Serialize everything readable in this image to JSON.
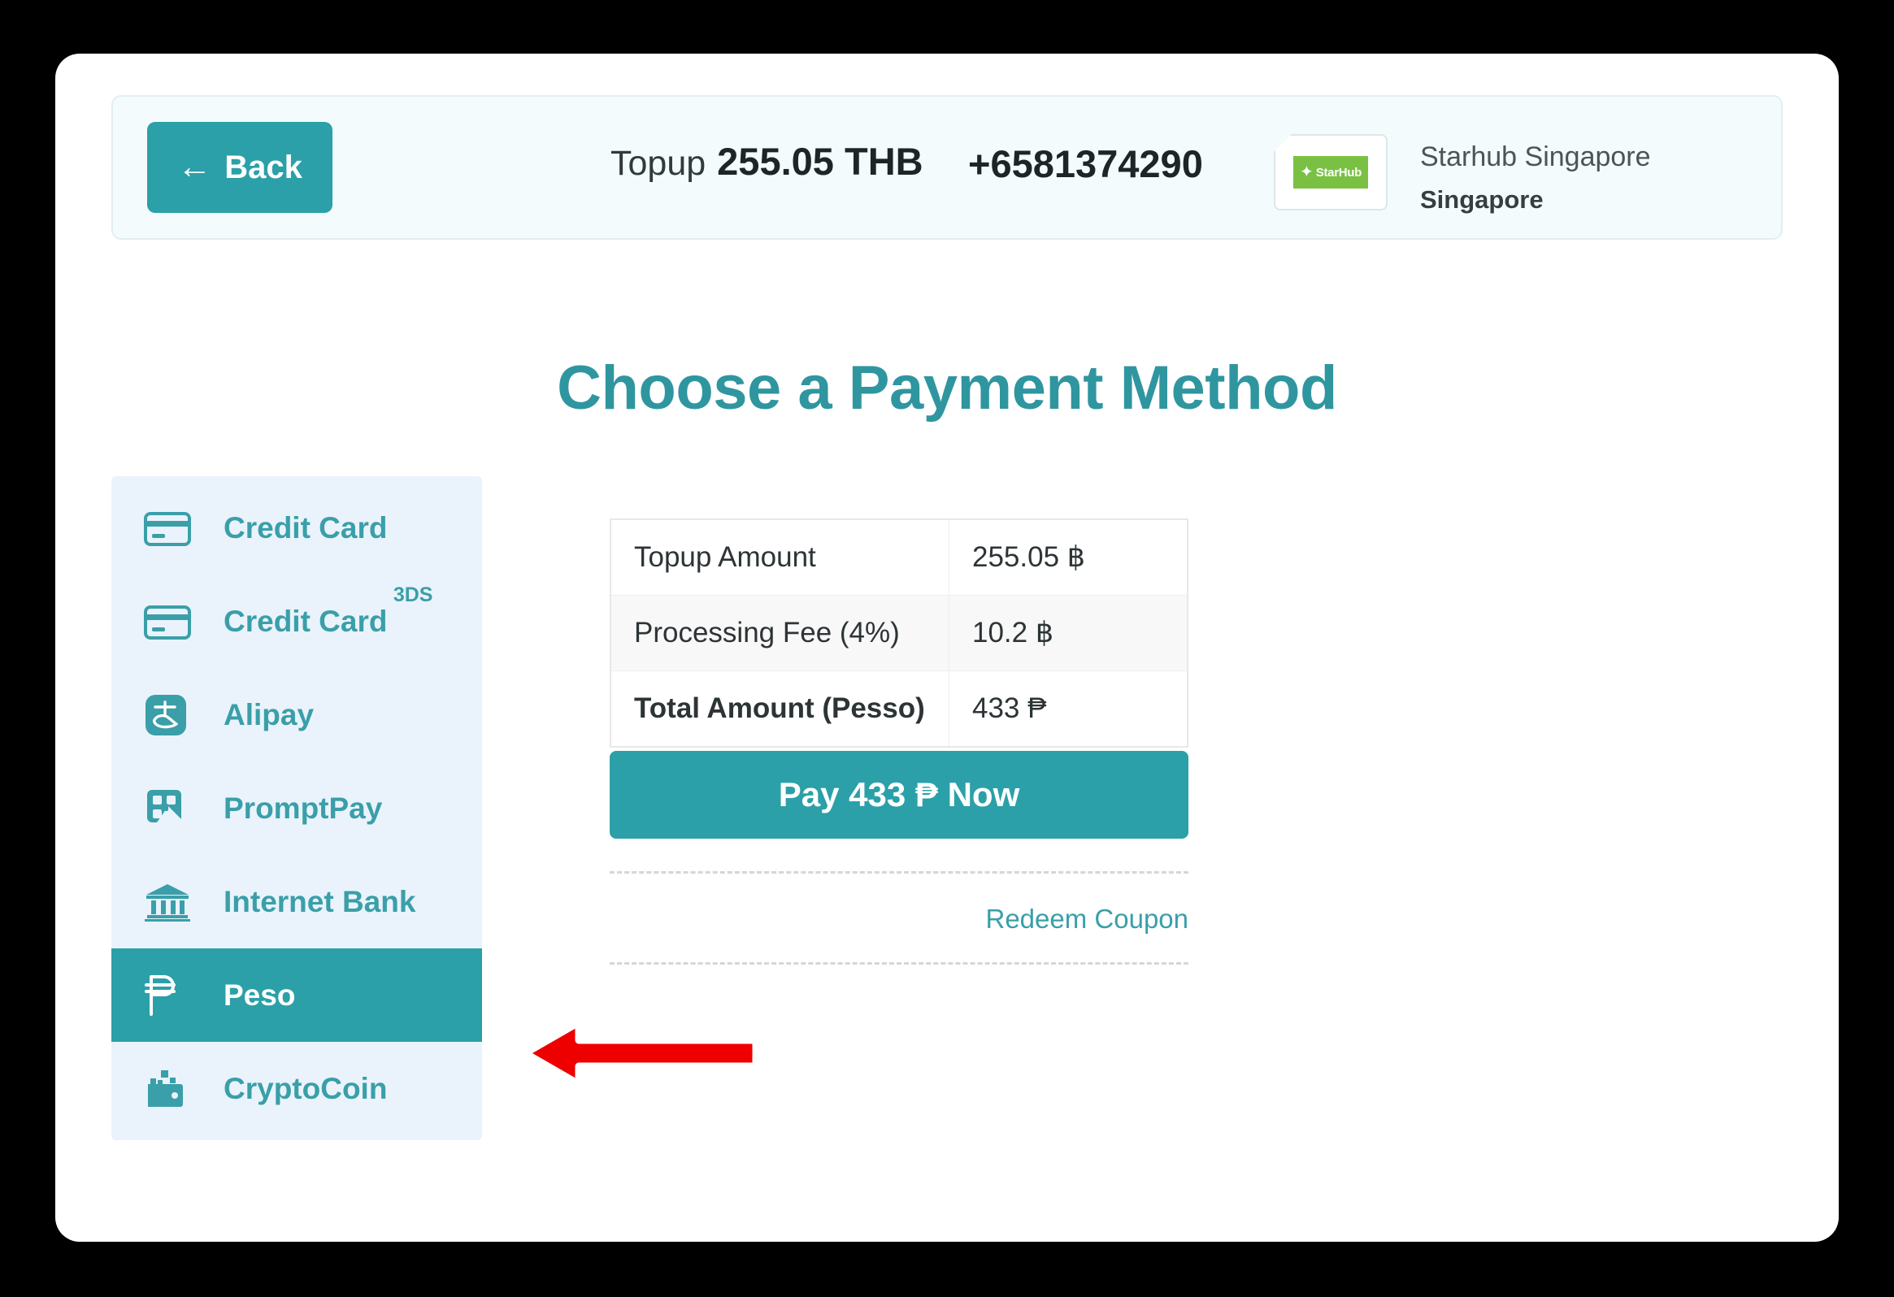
{
  "header": {
    "back_label": "Back",
    "back_icon": "arrow-left-icon",
    "topup_label": "Topup",
    "topup_amount": "255.05 THB",
    "phone_number": "+6581374290",
    "sim_logo_text": "StarHub",
    "sim_logo_icon": "starhub-star-icon",
    "operator_name": "Starhub Singapore",
    "operator_country": "Singapore"
  },
  "page": {
    "title": "Choose a Payment Method"
  },
  "payment_methods": [
    {
      "label": "Credit Card",
      "icon": "credit-card-icon",
      "badge": "",
      "active": false
    },
    {
      "label": "Credit Card",
      "icon": "credit-card-icon",
      "badge": "3DS",
      "active": false
    },
    {
      "label": "Alipay",
      "icon": "alipay-icon",
      "badge": "",
      "active": false
    },
    {
      "label": "PromptPay",
      "icon": "promptpay-qr-icon",
      "badge": "",
      "active": false
    },
    {
      "label": "Internet Bank",
      "icon": "bank-icon",
      "badge": "",
      "active": false
    },
    {
      "label": "Peso",
      "icon": "peso-icon",
      "badge": "",
      "active": true
    },
    {
      "label": "CryptoCoin",
      "icon": "crypto-wallet-icon",
      "badge": "",
      "active": false
    }
  ],
  "summary": {
    "rows": [
      {
        "label": "Topup Amount",
        "value": "255.05 ฿"
      },
      {
        "label": "Processing Fee (4%)",
        "value": "10.2 ฿"
      },
      {
        "label": "Total Amount (Pesso)",
        "value": "433 ₱"
      }
    ]
  },
  "actions": {
    "pay_label": "Pay 433 ₱ Now",
    "redeem_coupon_label": "Redeem Coupon"
  },
  "annotation": {
    "arrow_icon": "red-arrow-left-icon",
    "arrow_color": "#ee0000",
    "arrow_outline_color": "#ffffff"
  },
  "colors": {
    "accent_teal": "#2ba0a8",
    "header_bg": "#f4fbfc",
    "sidebar_bg": "#eaf3fb",
    "title_teal": "#2f96a0",
    "sim_green": "#7ac143"
  }
}
